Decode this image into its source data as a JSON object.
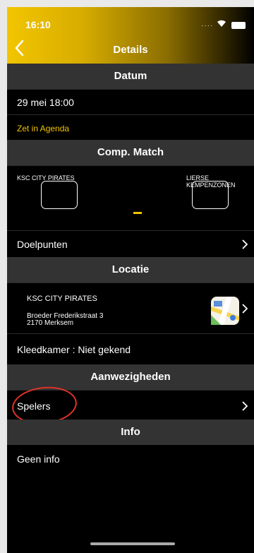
{
  "status": {
    "time": "16:10"
  },
  "nav": {
    "title": "Details"
  },
  "datum": {
    "header": "Datum",
    "value": "29 mei 18:00",
    "add_to_agenda": "Zet in Agenda"
  },
  "match": {
    "header": "Comp. Match",
    "home_team": "KSC CITY PIRATES",
    "away_team": "LIERSE KEMPENZONEN",
    "home_score": "",
    "away_score": "",
    "separator": "-"
  },
  "doelpunten": {
    "label": "Doelpunten"
  },
  "locatie": {
    "header": "Locatie",
    "name": "KSC CITY PIRATES",
    "street": "Broeder Frederikstraat 3",
    "city": "2170 Merksem",
    "kleedkamer": "Kleedkamer : Niet gekend"
  },
  "aanwezigheden": {
    "header": "Aanwezigheden",
    "spelers": "Spelers"
  },
  "info": {
    "header": "Info",
    "text": "Geen info"
  },
  "colors": {
    "accent": "#f1c400",
    "section_bg": "#333333",
    "annotation": "#e0332a"
  }
}
